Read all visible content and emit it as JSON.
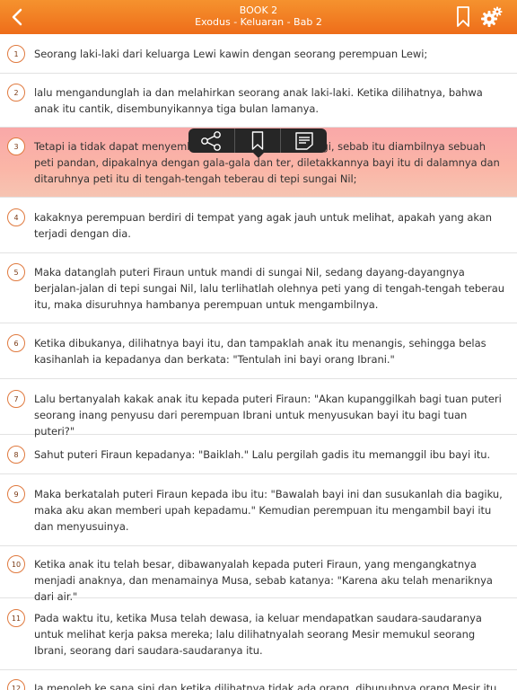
{
  "header": {
    "book_title": "BOOK 2",
    "chapter_title": "Exodus - Keluaran - Bab 2"
  },
  "colors": {
    "header_top": "#f5922e",
    "header_bottom": "#ee6d1a",
    "selected_verse": "#fbb6a7",
    "badge_border": "#e07a3f",
    "toolbar": "#262626"
  },
  "icons": {
    "back": "chevron-left-icon",
    "bookmark": "bookmark-icon",
    "settings": "gear-icon",
    "toolbar": [
      "share-icon",
      "bookmark-icon",
      "note-icon"
    ]
  },
  "selected_verse": "3",
  "verses": [
    {
      "num": "1",
      "text": "Seorang laki-laki dari keluarga Lewi kawin dengan seorang perempuan Lewi;"
    },
    {
      "num": "2",
      "text": "lalu mengandunglah ia dan melahirkan seorang anak laki-laki. Ketika dilihatnya, bahwa anak itu cantik, disembunyikannya tiga bulan lamanya."
    },
    {
      "num": "3",
      "text": "Tetapi ia tidak dapat menyembunyikannya lebih lama lagi, sebab itu diambilnya sebuah peti pandan, dipakalnya dengan gala-gala dan ter, diletakkannya bayi itu di dalamnya dan ditaruhnya peti itu di tengah-tengah teberau di tepi sungai Nil;"
    },
    {
      "num": "4",
      "text": "kakaknya perempuan berdiri di tempat yang agak jauh untuk melihat, apakah yang akan terjadi dengan dia."
    },
    {
      "num": "5",
      "text": "Maka datanglah puteri Firaun untuk mandi di sungai Nil, sedang dayang-dayangnya berjalan-jalan di tepi sungai Nil, lalu terlihatlah olehnya peti yang di tengah-tengah teberau itu, maka disuruhnya hambanya perempuan untuk mengambilnya."
    },
    {
      "num": "6",
      "text": "Ketika dibukanya, dilihatnya bayi itu, dan tampaklah anak itu menangis, sehingga belas kasihanlah ia kepadanya dan berkata: \"Tentulah ini bayi orang Ibrani.\""
    },
    {
      "num": "7",
      "text": "Lalu bertanyalah kakak anak itu kepada puteri Firaun: \"Akan kupanggilkah bagi tuan puteri seorang inang penyusu dari perempuan Ibrani untuk menyusukan bayi itu bagi tuan puteri?\""
    },
    {
      "num": "8",
      "text": "Sahut puteri Firaun kepadanya: \"Baiklah.\" Lalu pergilah gadis itu memanggil ibu bayi itu."
    },
    {
      "num": "9",
      "text": "Maka berkatalah puteri Firaun kepada ibu itu: \"Bawalah bayi ini dan susukanlah dia bagiku, maka aku akan memberi upah kepadamu.\" Kemudian perempuan itu mengambil bayi itu dan menyusuinya."
    },
    {
      "num": "10",
      "text": "Ketika anak itu telah besar, dibawanyalah kepada puteri Firaun, yang mengangkatnya menjadi anaknya, dan menamainya Musa, sebab katanya: \"Karena aku telah menariknya dari air.\""
    },
    {
      "num": "11",
      "text": "Pada waktu itu, ketika Musa telah dewasa, ia keluar mendapatkan saudara-saudaranya untuk melihat kerja paksa mereka; lalu dilihatnyalah seorang Mesir memukul seorang Ibrani, seorang dari saudara-saudaranya itu."
    },
    {
      "num": "12",
      "text": "Ia menoleh ke sana sini dan ketika dilihatnya tidak ada orang, dibunuhnya orang Mesir itu, dan"
    }
  ]
}
